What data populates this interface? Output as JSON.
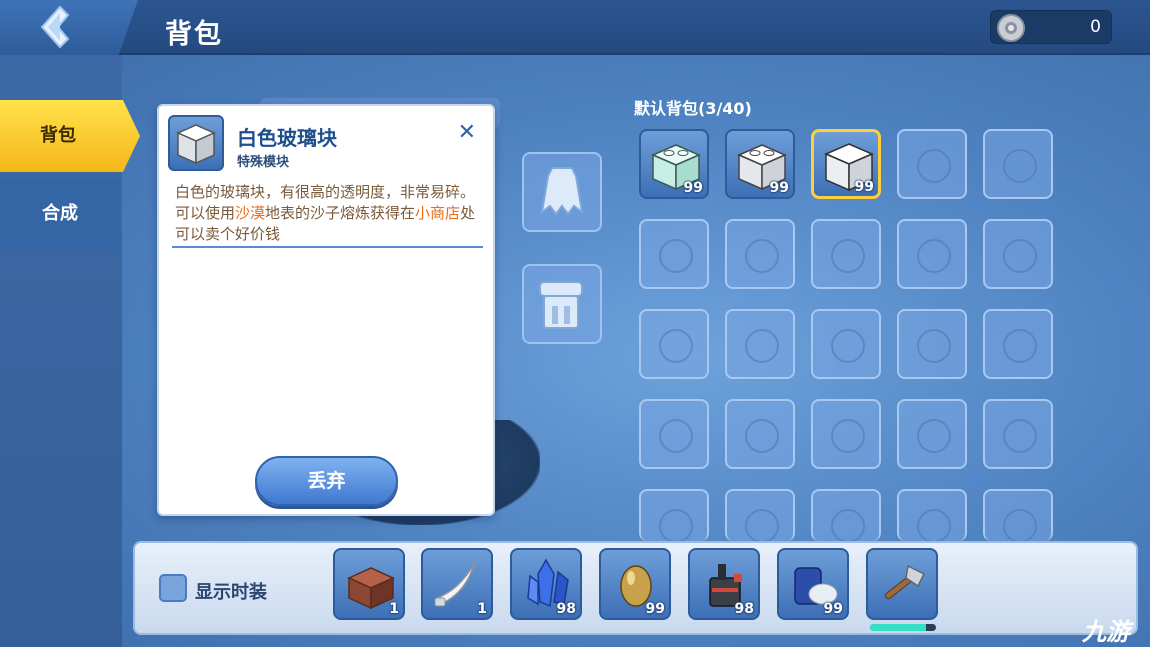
{
  "header": {
    "title": "背包",
    "coins": "0"
  },
  "sidebar": {
    "tabs": [
      {
        "label": "背包",
        "active": true
      },
      {
        "label": "合成",
        "active": false
      }
    ]
  },
  "detail": {
    "name": "白色玻璃块",
    "category": "特殊模块",
    "desc_part1": "白色的玻璃块，有很高的透明度，非常易碎。可以使用",
    "desc_hl1": "沙漠",
    "desc_part2": "地表的沙子熔炼获得在",
    "desc_hl2": "小商店",
    "desc_part3": "处可以卖个好价钱",
    "close_label": "✕",
    "discard_label": "丢弃"
  },
  "inventory": {
    "title": "默认背包(3/40)",
    "items": [
      {
        "name": "light-cyan-block",
        "count": "99"
      },
      {
        "name": "white-block",
        "count": "99"
      },
      {
        "name": "white-glass-block",
        "count": "99",
        "selected": true
      }
    ]
  },
  "hotbar": {
    "show_costume_label": "显示时装",
    "items": [
      {
        "name": "brick-block",
        "count": "1"
      },
      {
        "name": "bone-blade",
        "count": "1"
      },
      {
        "name": "blue-crystal",
        "count": "98"
      },
      {
        "name": "golden-egg",
        "count": "99"
      },
      {
        "name": "machine-item",
        "count": "98"
      },
      {
        "name": "can-item",
        "count": "99"
      },
      {
        "name": "axe"
      }
    ],
    "axe_durability": 0.85
  },
  "watermark": {
    "brand": "九游"
  },
  "colors": {
    "accent_yellow": "#f5b719",
    "highlight_orange": "#ee6a1a",
    "primary_blue": "#3d6fb6"
  }
}
